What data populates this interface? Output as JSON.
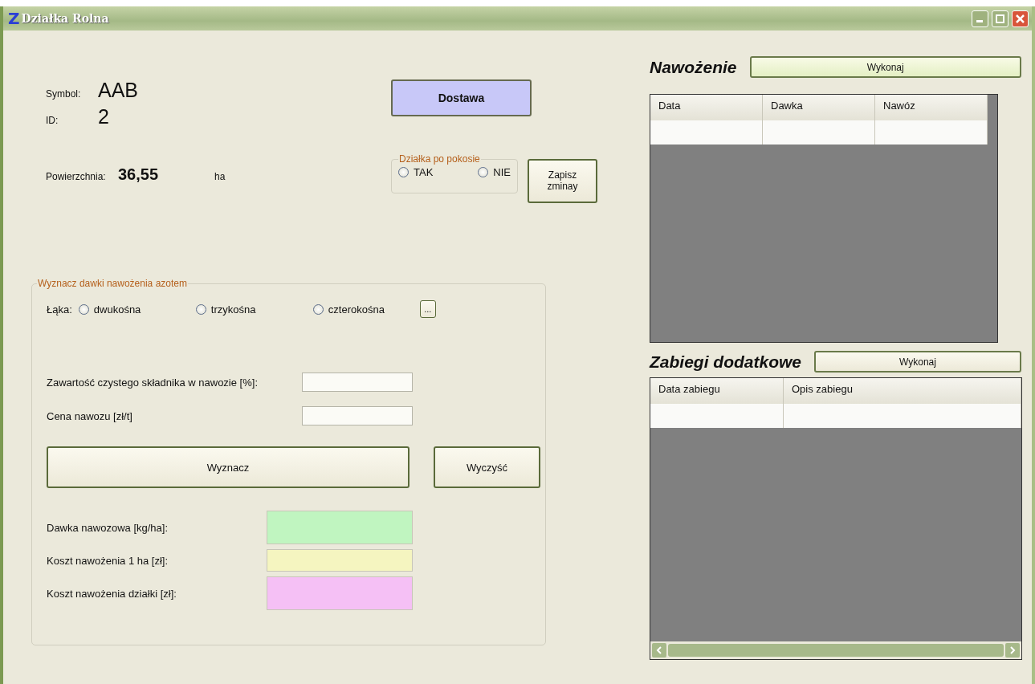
{
  "window": {
    "logo": "Z",
    "title": "Działka Rolna"
  },
  "info": {
    "symbol_label": "Symbol:",
    "symbol": "AAB",
    "id_label": "ID:",
    "id": "2",
    "area_label": "Powierzchnia:",
    "area": "36,55",
    "area_unit": "ha"
  },
  "delivery_button": "Dostawa",
  "after_mowing": {
    "title": "Działka po pokosie",
    "options": [
      {
        "label": "TAK",
        "selected": false
      },
      {
        "label": "NIE",
        "selected": false
      }
    ]
  },
  "save_button": "Zapisz zminay",
  "dose_group": {
    "title": "Wyznacz dawki nawożenia azotem",
    "meadow_label": "Łąka:",
    "meadow_options": [
      {
        "label": "dwukośna",
        "selected": false
      },
      {
        "label": "trzykośna",
        "selected": false
      },
      {
        "label": "czterokośna",
        "selected": false
      }
    ],
    "more_button": "...",
    "inputs": [
      {
        "label": "Zawartość czystego składnika w nawozie [%]:"
      },
      {
        "label": "Cena nawozu [zł/t]"
      }
    ],
    "calculate_button": "Wyznacz",
    "clear_button": "Wyczyść",
    "results": [
      {
        "label": "Dawka nawozowa [kg/ha]:",
        "color": "#c0f5c0"
      },
      {
        "label": "Koszt nawożenia 1 ha [zł]:",
        "color": "#f5f5c0"
      },
      {
        "label": "Koszt nawożenia działki [zł]:",
        "color": "#f5c0f5"
      }
    ]
  },
  "fertilizing": {
    "title": "Nawożenie",
    "button": "Wykonaj",
    "columns": [
      "Data",
      "Dawka",
      "Nawóz"
    ]
  },
  "extra": {
    "title": "Zabiegi dodatkowe",
    "button": "Wykonaj",
    "columns": [
      "Data zabiegu",
      "Opis zabiegu"
    ]
  }
}
